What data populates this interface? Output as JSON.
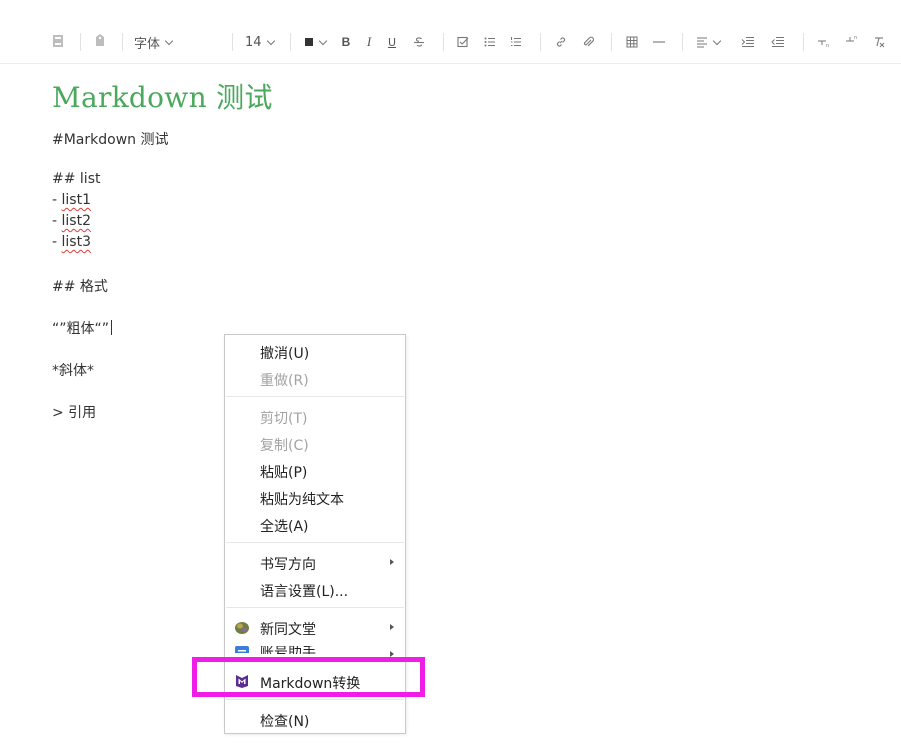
{
  "toolbar": {
    "font_label": "字体",
    "size_label": "14",
    "icons": [
      "notebook-icon",
      "tag-icon",
      "font-color-icon",
      "bold-icon",
      "italic-icon",
      "underline-icon",
      "strikethrough-icon",
      "checkbox-icon",
      "bullet-list-icon",
      "numbered-list-icon",
      "link-icon",
      "attachment-icon",
      "table-icon",
      "horizontal-rule-icon",
      "align-icon",
      "indent-icon",
      "outdent-icon",
      "subscript-icon",
      "superscript-icon",
      "clear-format-icon"
    ]
  },
  "note": {
    "title": "Markdown 测试",
    "lines": {
      "h1": "#Markdown 测试",
      "h2_list": "## list",
      "item_prefix": "- ",
      "item1": "list1",
      "item2": "list2",
      "item3": "list3",
      "h2_format": "## 格式",
      "bold": "“”粗体“”",
      "italic": "*斜体*",
      "quote": "> 引用"
    }
  },
  "context_menu": {
    "undo": "撤消(U)",
    "redo": "重做(R)",
    "cut": "剪切(T)",
    "copy": "复制(C)",
    "paste": "粘贴(P)",
    "paste_plain": "粘贴为纯文本",
    "select_all": "全选(A)",
    "writing_direction": "书写方向",
    "language_settings": "语言设置(L)...",
    "xintong_wentang": "新同文堂",
    "account_helper": "账号助手",
    "markdown_convert": "Markdown转换",
    "inspect": "检查(N)"
  },
  "colors": {
    "title_green": "#4aa95c",
    "highlight_magenta": "#ee1ee6",
    "markdown_icon_purple": "#5b2d91"
  }
}
